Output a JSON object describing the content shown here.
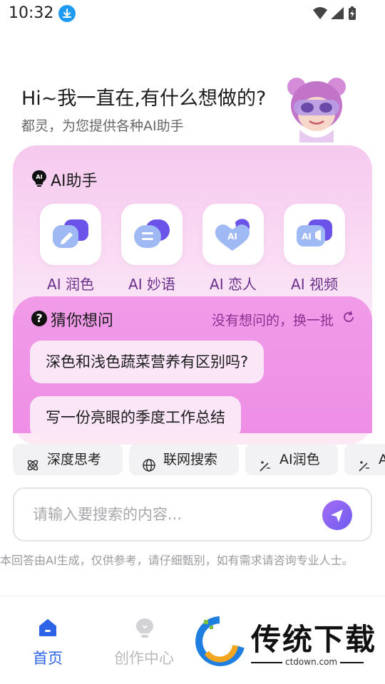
{
  "status_bar": {
    "time": "10:32"
  },
  "greeting": {
    "title": "Hi~我一直在,有什么想做的?",
    "subtitle": "都灵，为您提供各种AI助手"
  },
  "assistant": {
    "title": "AI助手",
    "tools": [
      {
        "label": "AI 润色",
        "icon": "pen-chat-icon"
      },
      {
        "label": "AI 妙语",
        "icon": "equals-chat-icon"
      },
      {
        "label": "AI 恋人",
        "icon": "heart-ai-icon"
      },
      {
        "label": "AI 视频",
        "icon": "video-ai-icon"
      }
    ]
  },
  "guess": {
    "title": "猜你想问",
    "refresh_label": "没有想问的，换一批",
    "suggestions": [
      "深色和浅色蔬菜营养有区别吗?",
      "写一份亮眼的季度工作总结"
    ]
  },
  "chips": [
    {
      "label": "深度思考",
      "icon": "atom-icon"
    },
    {
      "label": "联网搜索",
      "icon": "globe-icon"
    },
    {
      "label": "AI润色",
      "icon": "magic-wand-icon"
    },
    {
      "label": "AI",
      "icon": "magic-wand-icon"
    }
  ],
  "search": {
    "placeholder": "请输入要搜索的内容..."
  },
  "disclaimer": "本回答由AI生成，仅供参考，请仔细甄别，如有需求请咨询专业人士。",
  "nav": {
    "home": "首页",
    "create": "创作中心"
  },
  "watermark": {
    "name": "传统下载",
    "url": "ctdown.com"
  },
  "colors": {
    "accent_blue": "#2d63e6",
    "purple_text": "#6a2f8a",
    "card_pink": "#f19be8"
  }
}
